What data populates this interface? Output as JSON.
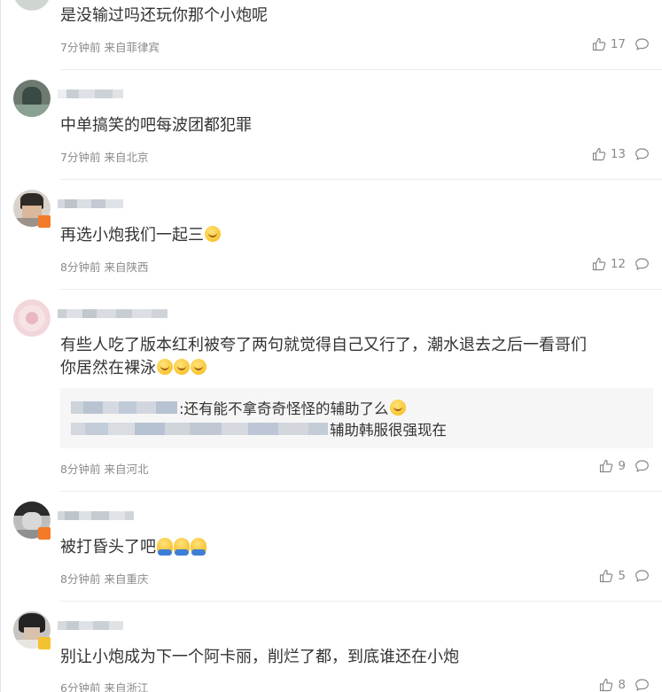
{
  "comments": [
    {
      "text": "是没输过吗还玩你那个小炮呢",
      "time": "7分钟前",
      "location": "来自菲律宾",
      "likes": "17"
    },
    {
      "text": "中单搞笑的吧每波团都犯罪",
      "time": "7分钟前",
      "location": "来自北京",
      "likes": "13"
    },
    {
      "text": "再选小炮我们一起三",
      "time": "8分钟前",
      "location": "来自陕西",
      "likes": "12"
    },
    {
      "text_line1": "有些人吃了版本红利被夸了两句就觉得自己又行了，潮水退去之后一看哥们",
      "text_line2": "你居然在裸泳",
      "replies": [
        {
          "text": ":还有能不拿奇奇怪怪的辅助了么"
        },
        {
          "text": "辅助韩服很强现在"
        }
      ],
      "time": "8分钟前",
      "location": "来自河北",
      "likes": "9"
    },
    {
      "text": "被打昏头了吧",
      "time": "8分钟前",
      "location": "来自重庆",
      "likes": "5"
    },
    {
      "text": "别让小炮成为下一个阿卡丽，削烂了都，到底谁还在小炮",
      "time": "6分钟前",
      "location": "来自浙江",
      "likes": "8"
    }
  ],
  "icons": {
    "like": "thumbs-up-icon",
    "reply": "comment-bubble-icon"
  },
  "colors": {
    "text": "#333333",
    "meta": "#8a8a8a",
    "divider": "#ececec",
    "reply_bg": "#f6f6f6",
    "badge": "#f27a28"
  }
}
